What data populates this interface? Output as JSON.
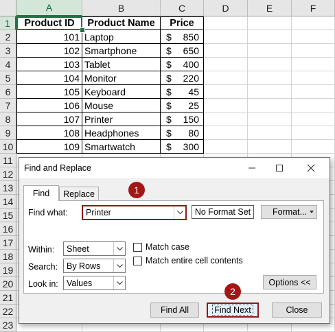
{
  "sheet": {
    "columns": [
      "A",
      "B",
      "C",
      "D",
      "E",
      "F"
    ],
    "rows": [
      "1",
      "2",
      "3",
      "4",
      "5",
      "6",
      "7",
      "8",
      "9",
      "10",
      "11",
      "12",
      "13",
      "14",
      "15",
      "16",
      "17",
      "18",
      "19",
      "20",
      "21",
      "22",
      "23"
    ],
    "headers": [
      "Product ID",
      "Product Name",
      "Price"
    ],
    "data": [
      {
        "id": "101",
        "name": "Laptop",
        "cur": "$",
        "price": "850"
      },
      {
        "id": "102",
        "name": "Smartphone",
        "cur": "$",
        "price": "650"
      },
      {
        "id": "103",
        "name": "Tablet",
        "cur": "$",
        "price": "400"
      },
      {
        "id": "104",
        "name": "Monitor",
        "cur": "$",
        "price": "220"
      },
      {
        "id": "105",
        "name": "Keyboard",
        "cur": "$",
        "price": "45"
      },
      {
        "id": "106",
        "name": "Mouse",
        "cur": "$",
        "price": "25"
      },
      {
        "id": "107",
        "name": "Printer",
        "cur": "$",
        "price": "150"
      },
      {
        "id": "108",
        "name": "Headphones",
        "cur": "$",
        "price": "80"
      },
      {
        "id": "109",
        "name": "Smartwatch",
        "cur": "$",
        "price": "300"
      }
    ],
    "accent": "#217346"
  },
  "dialog": {
    "title": "Find and Replace",
    "tabs": [
      "Find",
      "Replace"
    ],
    "find_what_label": "Find what:",
    "find_what_value": "Printer",
    "format_preview": "No Format Set",
    "format_button": "Format...",
    "within_label": "Within:",
    "within_value": "Sheet",
    "search_label": "Search:",
    "search_value": "By Rows",
    "lookin_label": "Look in:",
    "lookin_value": "Values",
    "match_case": "Match case",
    "match_entire": "Match entire cell contents",
    "options_button": "Options <<",
    "find_all": "Find All",
    "find_next": "Find Next",
    "close": "Close"
  },
  "callouts": [
    "1",
    "2"
  ],
  "icons": {
    "minimize": "minimize-icon",
    "maximize": "maximize-icon",
    "close": "close-icon",
    "dropdown": "chevron-down-icon"
  },
  "callout_color": "#a31616"
}
